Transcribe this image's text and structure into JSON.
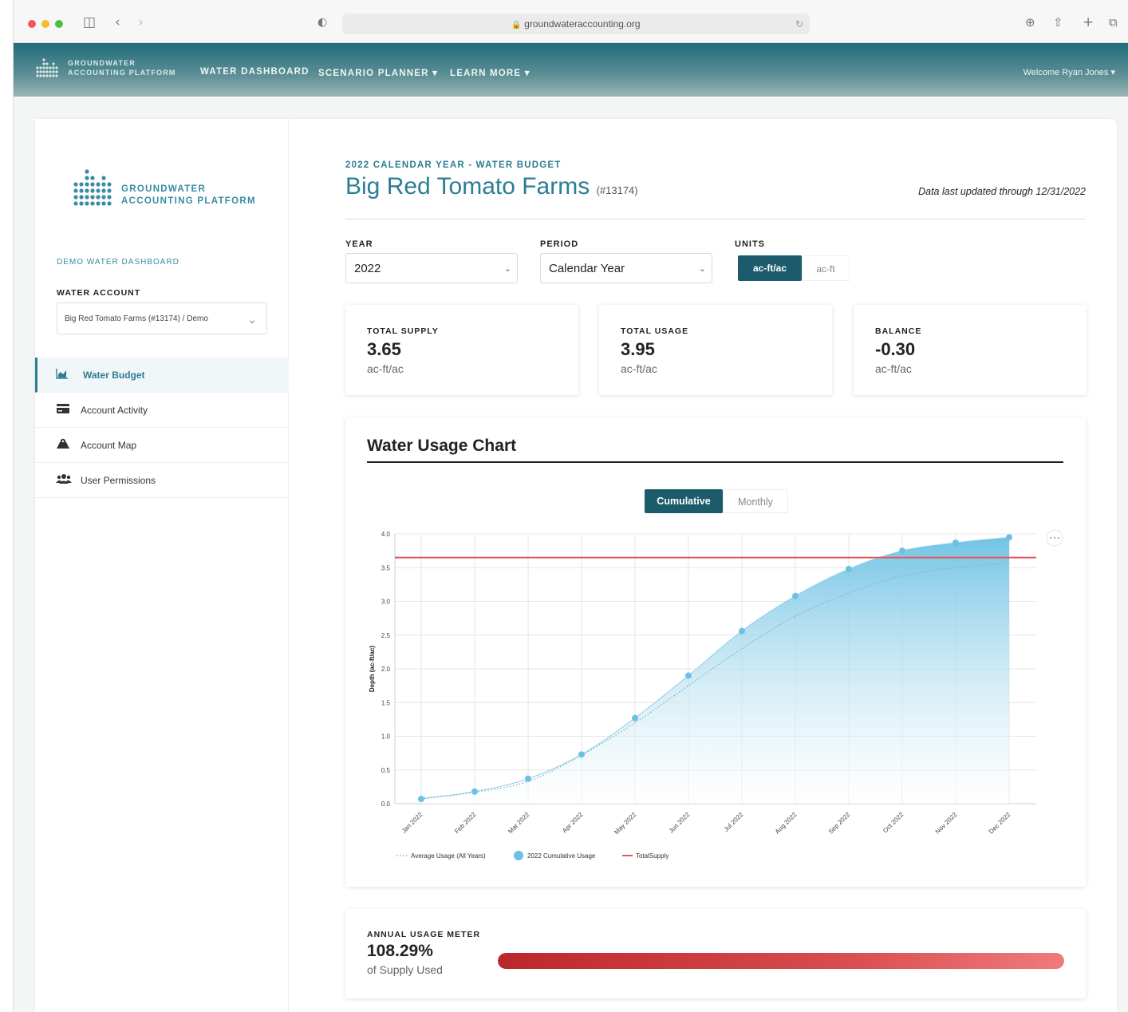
{
  "browser": {
    "url": "groundwateraccounting.org",
    "colors": {
      "close": "#ee5b55",
      "minimize": "#f4bd32",
      "zoom": "#4cc144"
    }
  },
  "topnav": {
    "brand_line1": "GROUNDWATER",
    "brand_line2": "ACCOUNTING PLATFORM",
    "links": [
      "WATER DASHBOARD",
      "SCENARIO PLANNER",
      "LEARN MORE"
    ],
    "welcome": "Welcome Ryan Jones"
  },
  "sidebar": {
    "logo_line1": "GROUNDWATER",
    "logo_line2": "ACCOUNTING PLATFORM",
    "demo_label": "DEMO WATER DASHBOARD",
    "account_label": "WATER ACCOUNT",
    "account_value": "Big Red Tomato Farms (#13174) / Demo",
    "items": [
      {
        "label": "Water Budget",
        "icon": "chart-area-icon"
      },
      {
        "label": "Account Activity",
        "icon": "credit-card-icon"
      },
      {
        "label": "Account Map",
        "icon": "map-marker-icon"
      },
      {
        "label": "User Permissions",
        "icon": "users-icon"
      }
    ]
  },
  "header": {
    "eyebrow": "2022 CALENDAR YEAR - WATER BUDGET",
    "title": "Big Red Tomato Farms",
    "account_id": "(#13174)",
    "updated": "Data last updated through 12/31/2022"
  },
  "filters": {
    "year_label": "YEAR",
    "year_value": "2022",
    "period_label": "PERIOD",
    "period_value": "Calendar Year",
    "units_label": "UNITS",
    "unit_active": "ac-ft/ac",
    "unit_inactive": "ac-ft"
  },
  "cards": [
    {
      "label": "TOTAL SUPPLY",
      "value": "3.65",
      "unit": "ac-ft/ac"
    },
    {
      "label": "TOTAL USAGE",
      "value": "3.95",
      "unit": "ac-ft/ac"
    },
    {
      "label": "BALANCE",
      "value": "-0.30",
      "unit": "ac-ft/ac"
    }
  ],
  "chart_card": {
    "title": "Water Usage Chart",
    "toggle_active": "Cumulative",
    "toggle_inactive": "Monthly",
    "more_icon": "ellipsis-icon"
  },
  "chart_data": {
    "type": "area",
    "ylabel": "Depth (ac-ft/ac)",
    "xlabel": "",
    "ylim": [
      0,
      4.0
    ],
    "yticks": [
      "0.0",
      "0.5",
      "1.0",
      "1.5",
      "2.0",
      "2.5",
      "3.0",
      "3.5",
      "4.0"
    ],
    "categories": [
      "Jan 2022",
      "Feb 2022",
      "Mar 2022",
      "Apr 2022",
      "May 2022",
      "Jun 2022",
      "Jul 2022",
      "Aug 2022",
      "Sep 2022",
      "Oct 2022",
      "Nov 2022",
      "Dec 2022"
    ],
    "series": [
      {
        "name": "Average Usage (All Years)",
        "style": "dotted-line",
        "color": "#8ab4c4",
        "values": [
          0.08,
          0.17,
          0.33,
          0.72,
          1.2,
          1.75,
          2.3,
          2.78,
          3.12,
          3.38,
          3.5,
          3.57
        ]
      },
      {
        "name": "2022 Cumulative Usage",
        "style": "area-points",
        "color": "#6cc0e3",
        "values": [
          0.07,
          0.18,
          0.37,
          0.73,
          1.27,
          1.9,
          2.56,
          3.08,
          3.48,
          3.75,
          3.87,
          3.95
        ]
      },
      {
        "name": "TotalSupply",
        "style": "line",
        "color": "#e05a5f",
        "values": [
          3.65,
          3.65,
          3.65,
          3.65,
          3.65,
          3.65,
          3.65,
          3.65,
          3.65,
          3.65,
          3.65,
          3.65
        ]
      }
    ],
    "grid": true,
    "legend": "bottom-left"
  },
  "meter": {
    "label": "ANNUAL USAGE METER",
    "value": "108.29%",
    "sub": "of Supply Used",
    "fill_fraction": 1.0
  }
}
